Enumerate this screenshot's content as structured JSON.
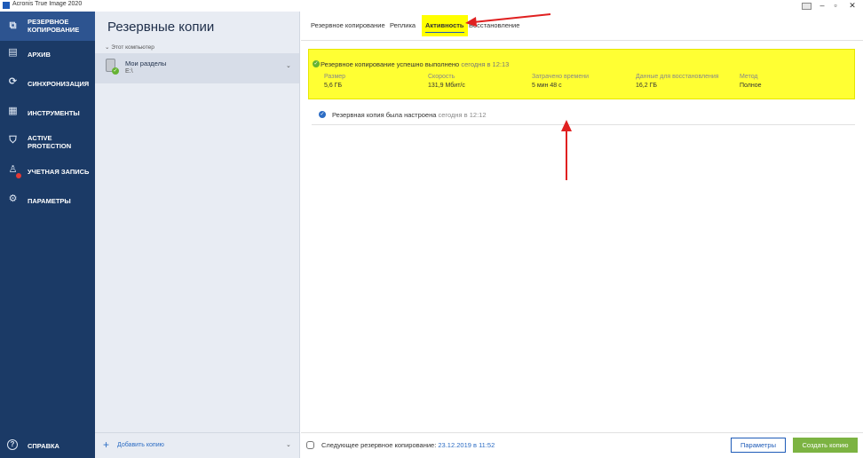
{
  "window": {
    "title": "Acronis True Image 2020"
  },
  "sidebar": {
    "items": [
      {
        "label": "РЕЗЕРВНОЕ\nКОПИРОВАНИЕ",
        "icon": "copy-icon",
        "active": true
      },
      {
        "label": "АРХИВ",
        "icon": "archive-icon"
      },
      {
        "label": "СИНХРОНИЗАЦИЯ",
        "icon": "sync-icon"
      },
      {
        "label": "ИНСТРУМЕНТЫ",
        "icon": "tools-grid-icon"
      },
      {
        "label": "ACTIVE\nPROTECTION",
        "icon": "shield-icon"
      },
      {
        "label": "УЧЕТНАЯ ЗАПИСЬ",
        "icon": "account-icon"
      },
      {
        "label": "ПАРАМЕТРЫ",
        "icon": "gear-icon"
      }
    ],
    "help": {
      "label": "СПРАВКА",
      "icon": "help-icon"
    }
  },
  "panel": {
    "title": "Резервные копии",
    "section": "Этот компьютер",
    "backup_item": {
      "name": "Мои разделы",
      "sub": "E:\\"
    },
    "add_label": "Добавить копию"
  },
  "tabs": [
    {
      "label": "Резервное копирование"
    },
    {
      "label": "Реплика"
    },
    {
      "label": "Активность",
      "active": true
    },
    {
      "label": "Восстановление"
    }
  ],
  "activity": [
    {
      "text": "Резервное копирование успешно выполнено",
      "time": "сегодня в 12:13",
      "status_color": "#66b333",
      "stats": [
        {
          "label": "Размер",
          "value": "5,6 ГБ"
        },
        {
          "label": "Скорость",
          "value": "131,9 Мбит/с"
        },
        {
          "label": "Затрачено времени",
          "value": "5 мин 48 с"
        },
        {
          "label": "Данные для восстановления",
          "value": "16,2 ГБ"
        },
        {
          "label": "Метод",
          "value": "Полное"
        }
      ]
    },
    {
      "text": "Резервная копия была настроена",
      "time": "сегодня в 12:12",
      "status_color": "#2d6dc4"
    }
  ],
  "footer": {
    "next_label": "Следующее резервное копирование:",
    "next_date": "23.12.2019 в 11:52",
    "params_button": "Параметры",
    "create_button": "Создать копию"
  },
  "colors": {
    "sidebar_bg": "#1b3a66",
    "highlight": "#ffff00",
    "accent": "#1e5bb8",
    "primary_button": "#7cb342",
    "annotation_arrow": "#e02020"
  }
}
